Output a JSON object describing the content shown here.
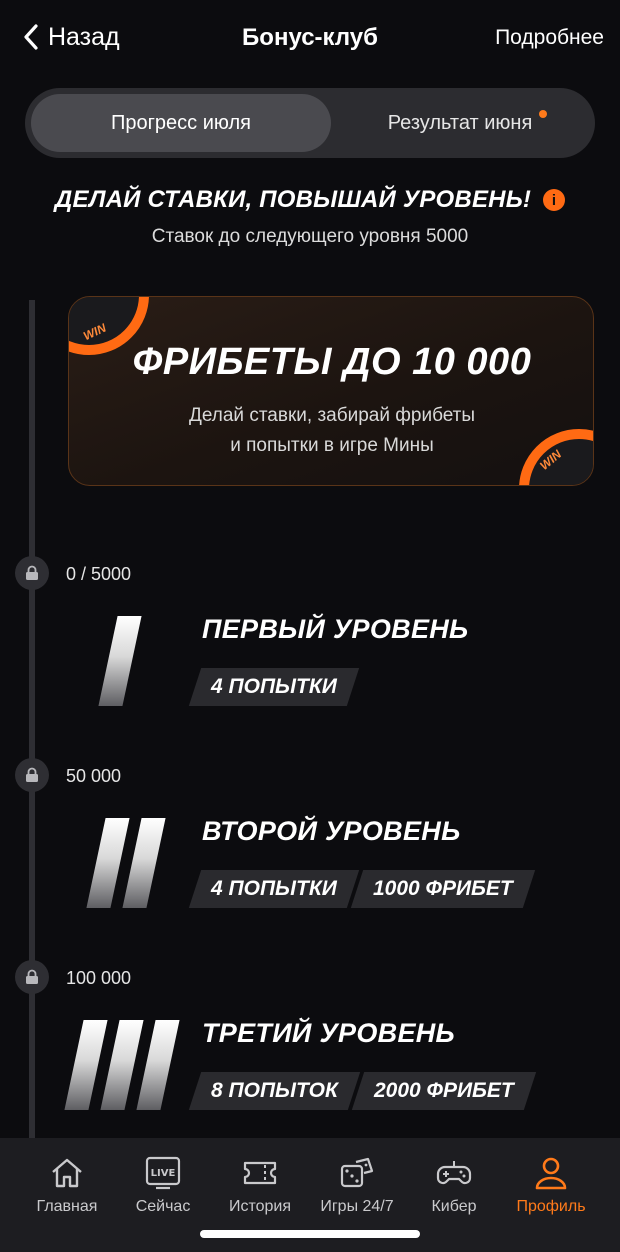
{
  "header": {
    "back_label": "Назад",
    "title": "Бонус-клуб",
    "more_label": "Подробнее"
  },
  "tabs": [
    {
      "label": "Прогресс июля",
      "active": true
    },
    {
      "label": "Результат июня",
      "active": false,
      "has_dot": true
    }
  ],
  "intro": {
    "headline": "ДЕЛАЙ СТАВКИ, ПОВЫШАЙ УРОВЕНЬ!",
    "info_icon_text": "i",
    "subline": "Ставок до следующего уровня 5000"
  },
  "promo": {
    "title": "ФРИБЕТЫ ДО 10 000",
    "line1": "Делай ставки, забирай фрибеты",
    "line2": "и попытки в игре Мины",
    "chip_label": "WIN"
  },
  "levels": [
    {
      "threshold": "0 / 5000",
      "title": "ПЕРВЫЙ УРОВЕНЬ",
      "rewards": [
        "4 ПОПЫТКИ"
      ]
    },
    {
      "threshold": "50 000",
      "title": "ВТОРОЙ УРОВЕНЬ",
      "rewards": [
        "4 ПОПЫТКИ",
        "1000 ФРИБЕТ"
      ]
    },
    {
      "threshold": "100 000",
      "title": "ТРЕТИЙ УРОВЕНЬ",
      "rewards": [
        "8 ПОПЫТОК",
        "2000 ФРИБЕТ"
      ]
    }
  ],
  "bottom_nav": [
    {
      "label": "Главная",
      "icon": "home-icon"
    },
    {
      "label": "Сейчас",
      "icon": "live-icon",
      "badge": "LIVE"
    },
    {
      "label": "История",
      "icon": "ticket-icon"
    },
    {
      "label": "Игры 24/7",
      "icon": "dice-icon"
    },
    {
      "label": "Кибер",
      "icon": "gamepad-icon"
    },
    {
      "label": "Профиль",
      "icon": "profile-icon",
      "active": true
    }
  ],
  "colors": {
    "accent": "#ff7a1a",
    "background": "#0c0c0f",
    "card": "#2a2a2e"
  }
}
